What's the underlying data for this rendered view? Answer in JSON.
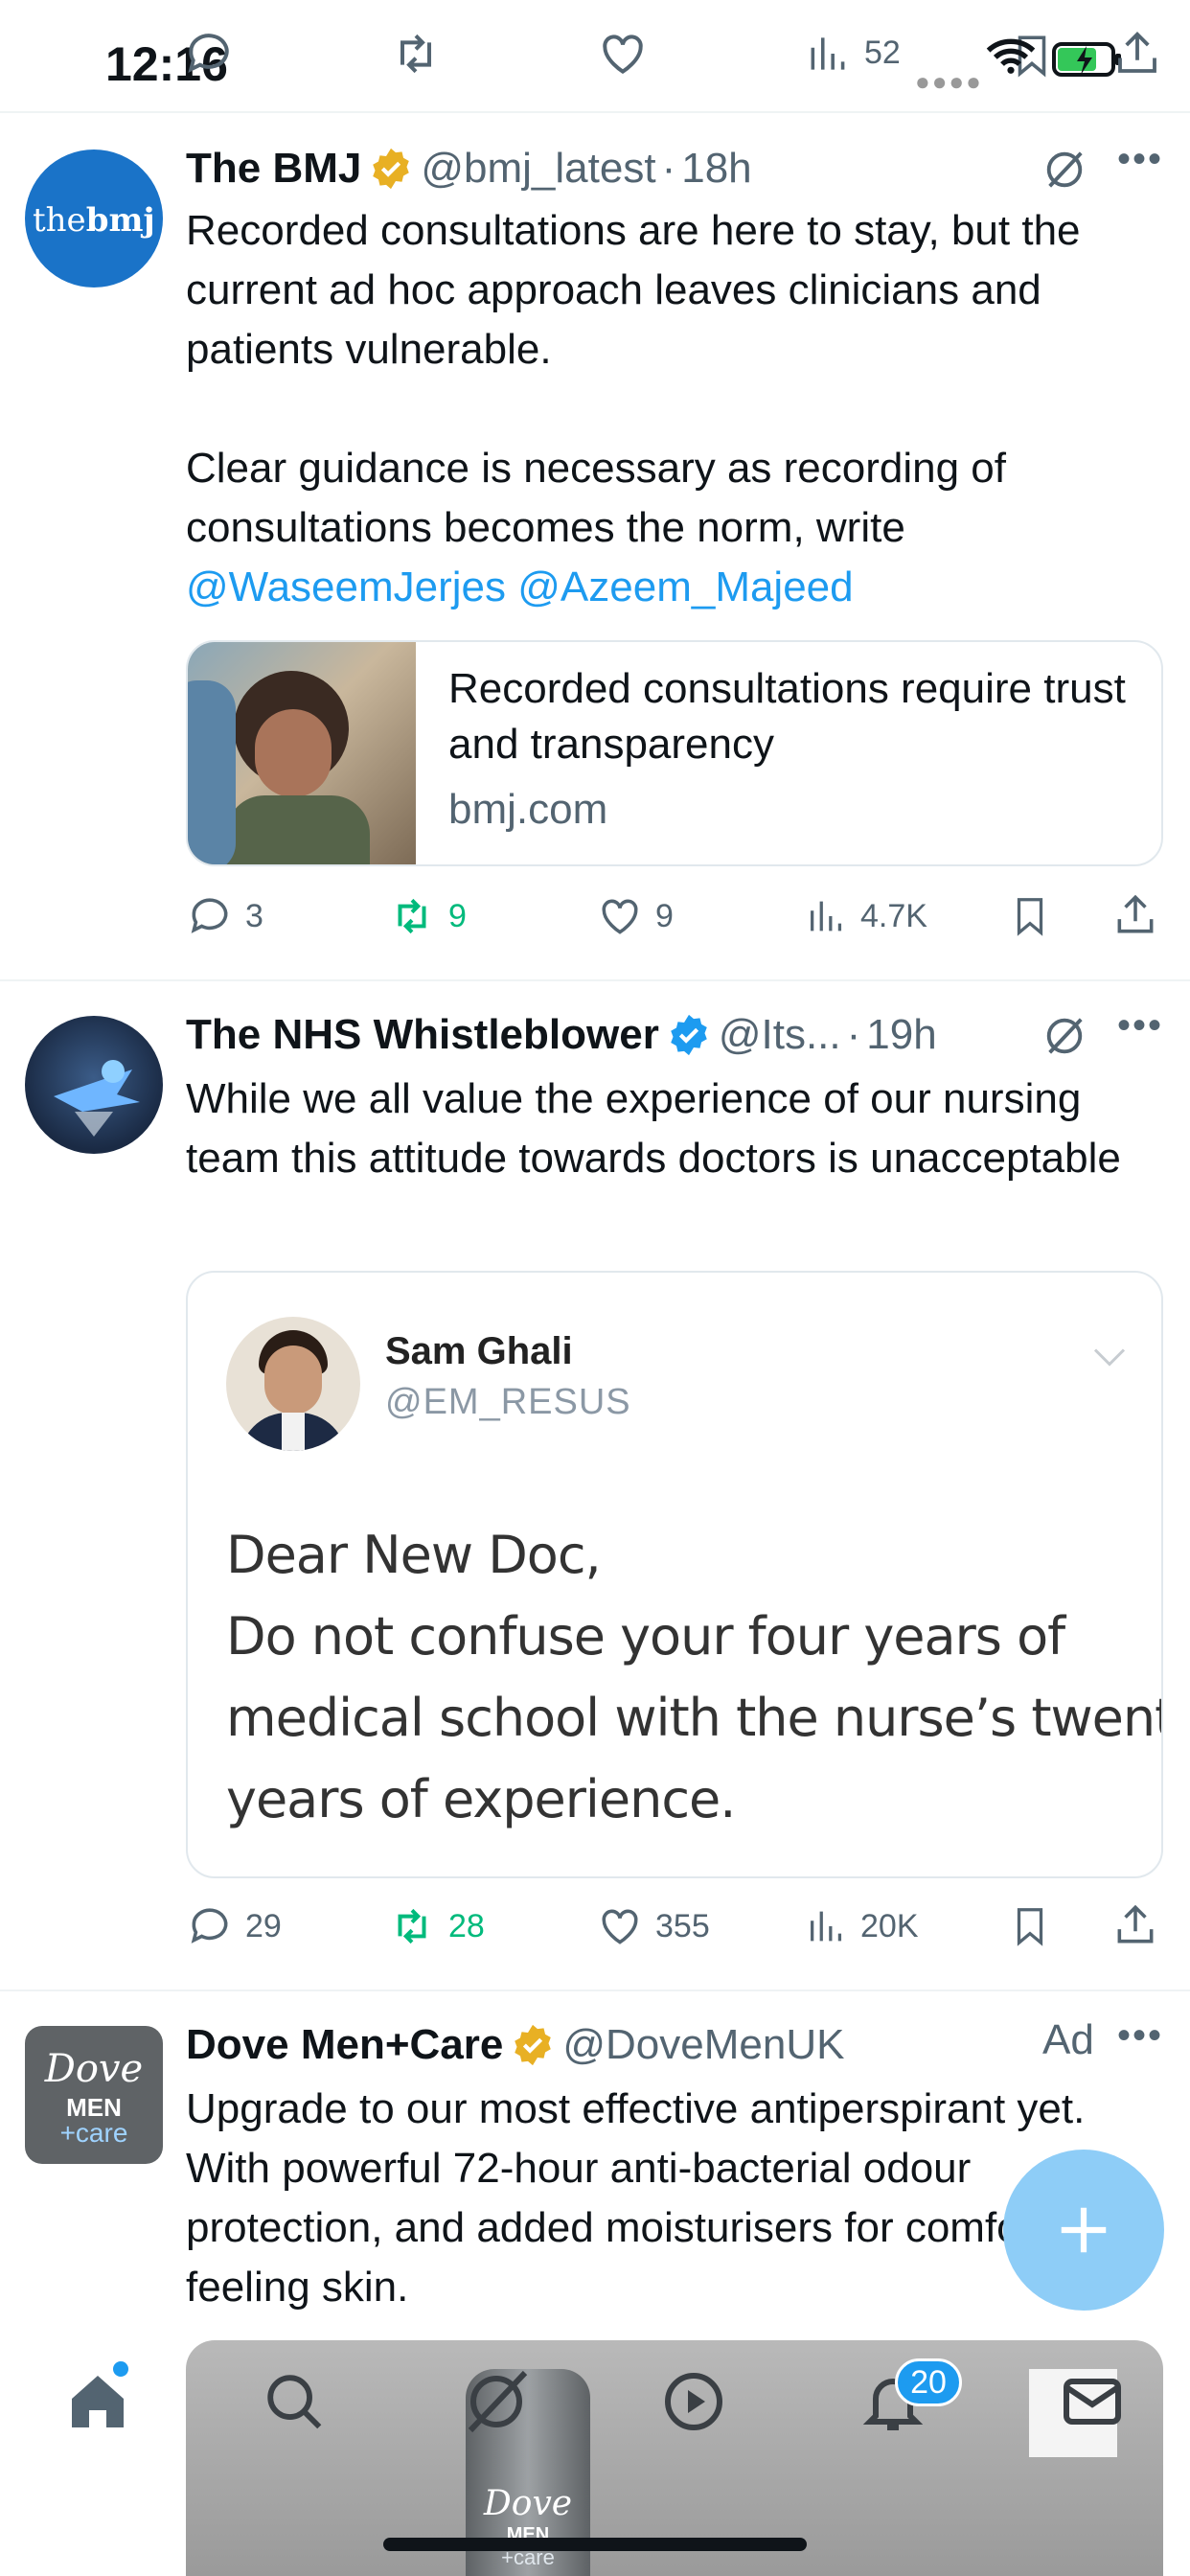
{
  "status_bar": {
    "time": "12:16",
    "battery": "charging",
    "top_views_count": "52"
  },
  "tweets": [
    {
      "name": "The BMJ",
      "verified": "gold",
      "handle": "@bmj_latest",
      "separator": "·",
      "time": "18h",
      "avatar_text": {
        "a": "the",
        "b": "bmj"
      },
      "text_p1": "Recorded consultations are here to stay, but the current ad hoc approach leaves clinicians and patients vulnerable.",
      "text_p2": "Clear guidance is necessary as recording of consultations becomes the norm, write",
      "mention1": "@WaseemJerjes",
      "mention2": "@Azeem_Majeed",
      "card": {
        "title": "Recorded consultations require trust and transparency",
        "domain": "bmj.com"
      },
      "counts": {
        "replies": "3",
        "reposts": "9",
        "likes": "9",
        "views": "4.7K"
      }
    },
    {
      "name": "The NHS Whistleblower",
      "verified": "blue",
      "handle": "@Its...",
      "separator": "·",
      "time": "19h",
      "text": "While we all value the experience of our nursing team this attitude towards doctors is unacceptable",
      "quote": {
        "name": "Sam Ghali",
        "handle": "@EM_RESUS",
        "lines": [
          "Dear New Doc,",
          "Do not confuse your four years of",
          "medical school with the nurse’s twenty",
          "years of experience."
        ]
      },
      "counts": {
        "replies": "29",
        "reposts": "28",
        "likes": "355",
        "views": "20K"
      }
    },
    {
      "name": "Dove Men+Care",
      "verified": "gold",
      "handle": "@DoveMenUK",
      "ad_label": "Ad",
      "avatar_text": {
        "a": "Dove",
        "b": "MEN",
        "c": "+care"
      },
      "text": "Upgrade to our most effective antiperspirant yet. With powerful 72-hour anti-bacterial odour protection, and added moisturisers for comfortable feeling skin.",
      "media_text": {
        "a": "Dove",
        "b": "MEN",
        "c": "+care"
      }
    }
  ],
  "nav": {
    "items": [
      "home-icon",
      "search-icon",
      "grok-icon",
      "video-icon",
      "notifications-icon",
      "messages-icon"
    ],
    "notification_count": "20"
  },
  "colors": {
    "link": "#1d9bf0",
    "repost_active": "#00ba7c",
    "gold_badge": "#e8b024",
    "blue_badge": "#1d9bf0",
    "fab": "#8ecdf7"
  }
}
